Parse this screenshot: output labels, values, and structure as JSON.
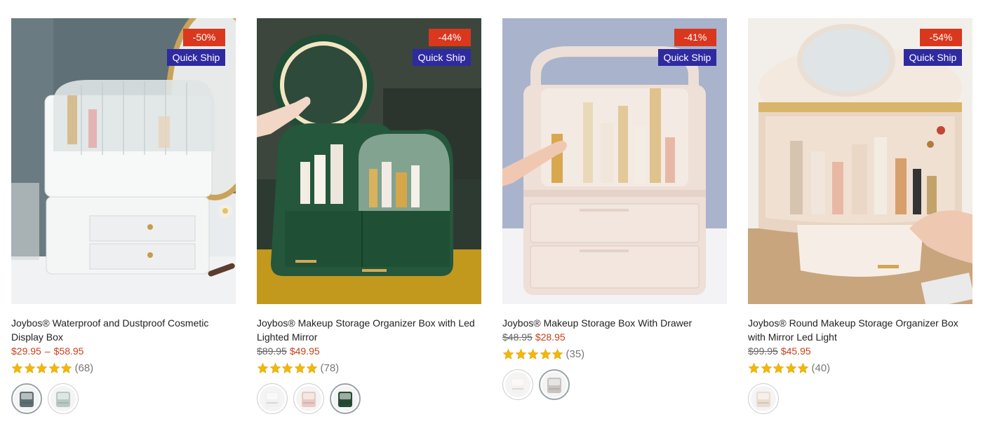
{
  "products": [
    {
      "discount": "-50%",
      "ship_badge": "Quick Ship",
      "title": "Joybos® Waterproof and Dustproof Cosmetic Display Box",
      "price_low": "$29.95",
      "price_sep": "–",
      "price_high": "$58.95",
      "rating": 5,
      "review_count": "(68)",
      "swatch_colors": [
        "#5d6f72",
        "#b9c8c2"
      ]
    },
    {
      "discount": "-44%",
      "ship_badge": "Quick Ship",
      "title": "Joybos® Makeup Storage Organizer Box with Led Lighted Mirror",
      "old_price": "$89.95",
      "price": "$49.95",
      "rating": 5,
      "review_count": "(78)",
      "swatch_colors": [
        "#f1f1f1",
        "#e8c9c4",
        "#254a34"
      ]
    },
    {
      "discount": "-41%",
      "ship_badge": "Quick Ship",
      "title": "Joybos® Makeup Storage Box With Drawer",
      "old_price": "$48.95",
      "price": "$28.95",
      "rating": 5,
      "review_count": "(35)",
      "swatch_colors": [
        "#f4f2ee",
        "#c9c3bf"
      ]
    },
    {
      "discount": "-54%",
      "ship_badge": "Quick Ship",
      "title": "Joybos® Round Makeup Storage Organizer Box with Mirror Led Light",
      "old_price": "$99.95",
      "price": "$45.95",
      "rating": 5,
      "review_count": "(40)",
      "swatch_colors": [
        "#e9ddd0"
      ]
    }
  ],
  "colors": {
    "discount_badge": "#d9381e",
    "ship_badge": "#2e2aa0",
    "price": "#c8401b",
    "star": "#f5b800"
  }
}
